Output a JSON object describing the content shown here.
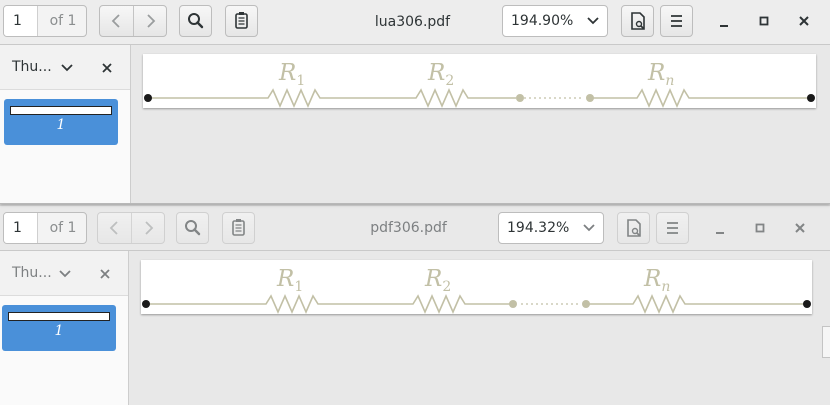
{
  "windows": [
    {
      "page_number": "1",
      "page_of": "of 1",
      "title": "lua306.pdf",
      "zoom": "194.90%",
      "sidebar_label": "Thu...",
      "thumbnail_label": "1",
      "figure": {
        "r1": "R",
        "r1_sub": "1",
        "r2": "R",
        "r2_sub": "2",
        "rn": "R",
        "rn_sub": "n"
      }
    },
    {
      "page_number": "1",
      "page_of": "of 1",
      "title": "pdf306.pdf",
      "zoom": "194.32%",
      "sidebar_label": "Thu...",
      "thumbnail_label": "1",
      "figure": {
        "r1": "R",
        "r1_sub": "1",
        "r2": "R",
        "r2_sub": "2",
        "rn": "R",
        "rn_sub": "n"
      }
    }
  ],
  "icons": {
    "prev": "chevron-left-icon",
    "next": "chevron-right-icon",
    "search": "search-icon",
    "annotations": "clipboard-icon",
    "zoom_dropdown": "chevron-down-icon",
    "page_view": "document-icon",
    "menu": "hamburger-menu-icon",
    "minimize": "minimize-icon",
    "maximize": "maximize-icon",
    "close": "close-icon",
    "sidebar_dropdown": "chevron-down-icon",
    "sidebar_close": "close-icon"
  },
  "colors": {
    "circuit": "#c2c0a6",
    "node": "#1a1a1a",
    "thumbnail_selected": "#4a90d9"
  }
}
